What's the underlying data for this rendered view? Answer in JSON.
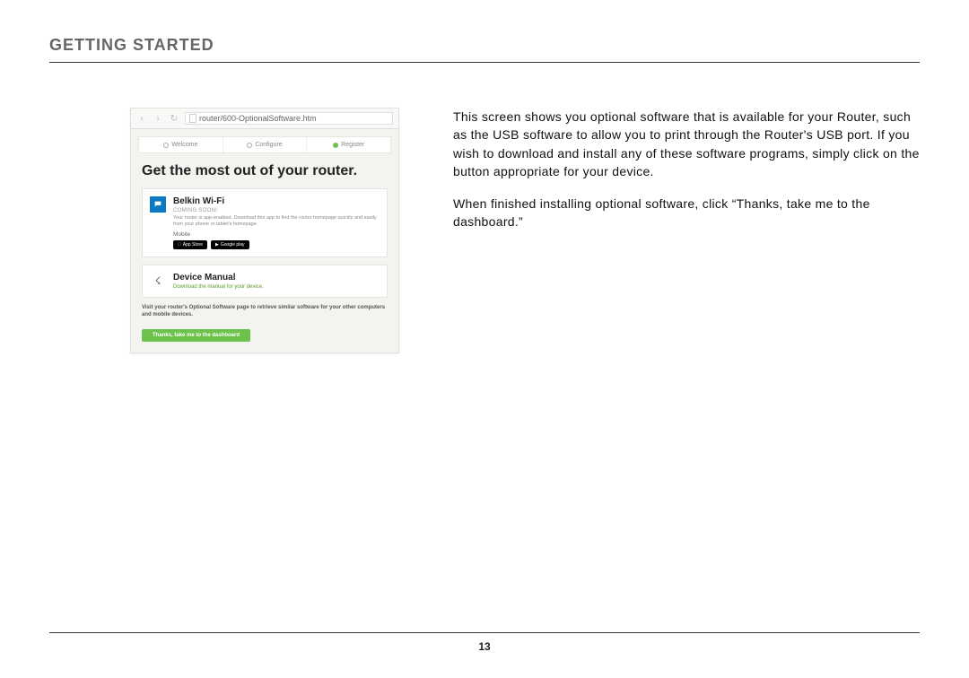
{
  "header": {
    "title": "GETTING STARTED"
  },
  "right": {
    "p1": "This screen shows you optional software that is available for your Router, such as the USB software to allow you to print through the Router's USB port. If you wish to download and install any of these software programs, simply click on the button appropriate for your device.",
    "p2": "When finished installing optional software, click “Thanks, take me to the dashboard.”"
  },
  "screenshot": {
    "url": "router/600-OptionalSoftware.htm",
    "tabs": [
      {
        "label": "Welcome",
        "active": false
      },
      {
        "label": "Configure",
        "active": false
      },
      {
        "label": "Register",
        "active": true
      }
    ],
    "heading": "Get the most out of your router.",
    "card_wifi": {
      "title": "Belkin Wi-Fi",
      "sub": "COMING SOON!",
      "desc": "Your router is app-enabled. Download this app to find the router homepage quickly and easily from your phone or tablet's homepage.",
      "mobile_label": "Mobile",
      "appstore": "App Store",
      "googleplay": "Google play"
    },
    "card_manual": {
      "title": "Device Manual",
      "link": "Download the manual for your device."
    },
    "footnote": "Visit your router's Optional Software page to retrieve similar software for your other computers and mobile devices.",
    "dashboard_btn": "Thanks, take me to the dashboard"
  },
  "page_number": "13"
}
